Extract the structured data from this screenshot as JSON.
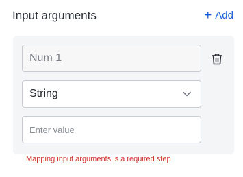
{
  "header": {
    "title": "Input arguments",
    "add_label": "Add"
  },
  "argument": {
    "name_value": "Num 1",
    "type_selected": "String",
    "value_placeholder": "Enter value"
  },
  "error_message": "Mapping input arguments is a required step",
  "colors": {
    "accent": "#1a5dd6",
    "error": "#d0342c",
    "panel_bg": "#f4f5f7"
  }
}
